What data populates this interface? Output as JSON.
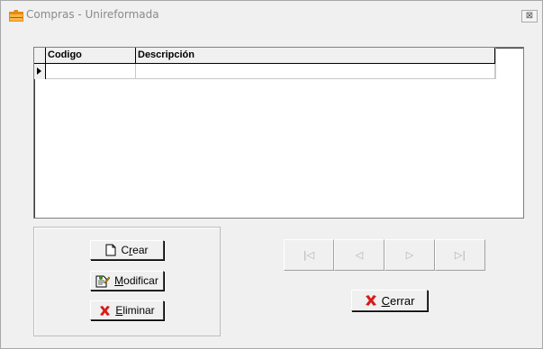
{
  "window": {
    "title": "Compras - Unireformada",
    "close_glyph": "⊠"
  },
  "grid": {
    "columns": [
      {
        "label": "Codigo"
      },
      {
        "label": "Descripción"
      }
    ],
    "rows": [
      {
        "codigo": "",
        "descripcion": ""
      }
    ]
  },
  "actions": {
    "crear": {
      "pre": "C",
      "accel": "r",
      "post": "ear"
    },
    "modificar": {
      "pre": "",
      "accel": "M",
      "post": "odificar"
    },
    "eliminar": {
      "pre": "",
      "accel": "E",
      "post": "liminar"
    },
    "cerrar": {
      "pre": "",
      "accel": "C",
      "post": "errar"
    }
  },
  "navigation": {
    "first": "|◁",
    "prev": "◁",
    "next": "▷",
    "last": "▷|"
  },
  "colors": {
    "close_x": "#d81b1b",
    "title_text": "#8a8a8a",
    "disabled": "#b0b0b0"
  }
}
